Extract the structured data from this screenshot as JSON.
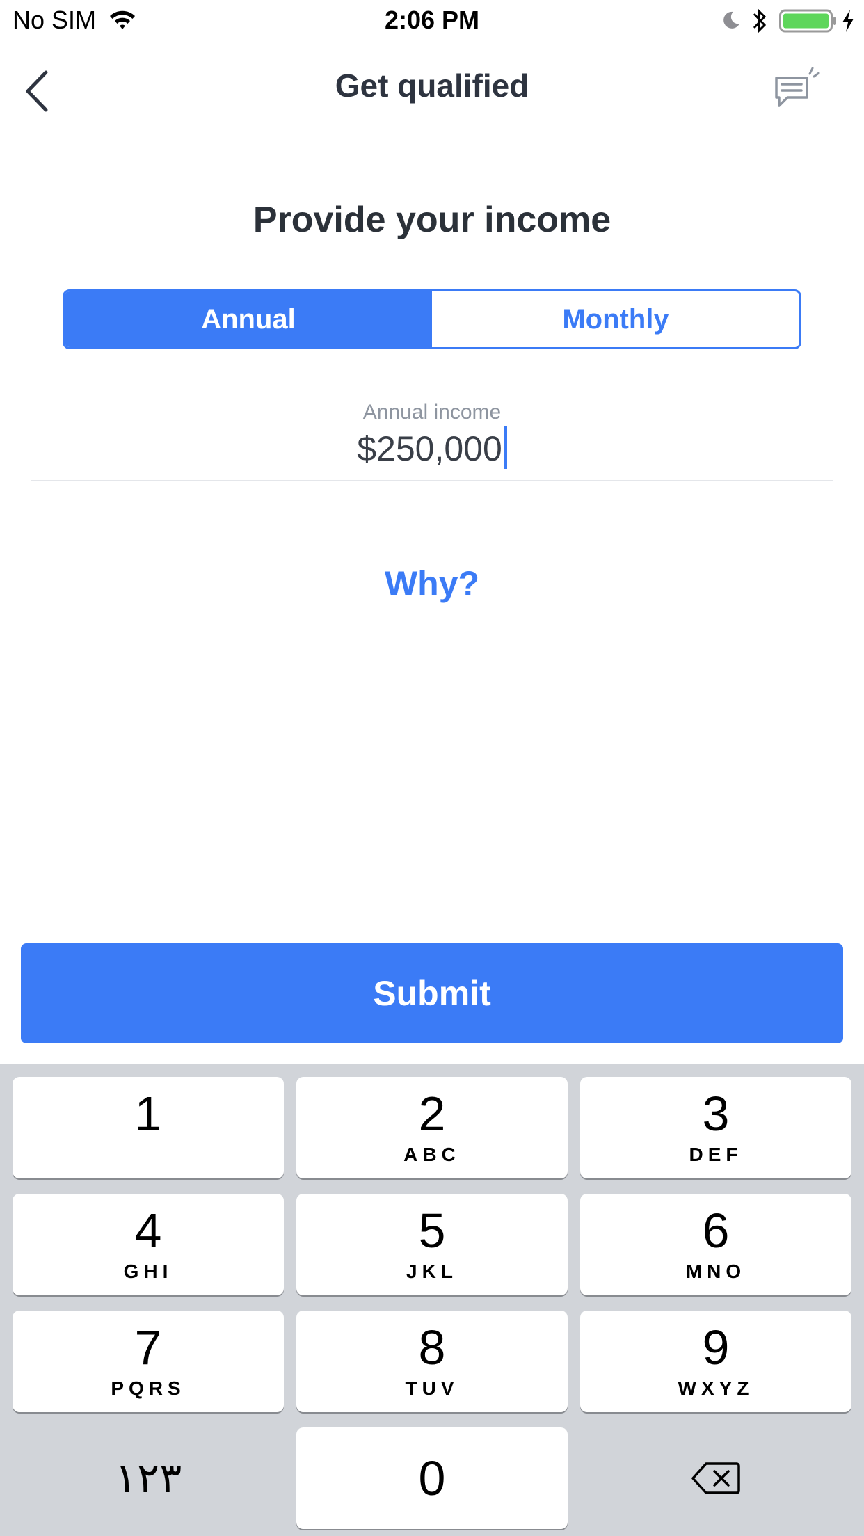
{
  "status_bar": {
    "carrier": "No SIM",
    "time": "2:06 PM",
    "battery_color": "#5ed65b"
  },
  "nav": {
    "title": "Get qualified",
    "back_icon": "chevron-left-icon",
    "chat_icon": "chat-bubble-icon"
  },
  "heading": "Provide your income",
  "segment": {
    "options": [
      "Annual",
      "Monthly"
    ],
    "selected": "Annual"
  },
  "income_field": {
    "label": "Annual income",
    "value": "$250,000"
  },
  "why_link": "Why?",
  "submit_label": "Submit",
  "keyboard": {
    "keys": [
      {
        "num": "1",
        "letters": ""
      },
      {
        "num": "2",
        "letters": "ABC"
      },
      {
        "num": "3",
        "letters": "DEF"
      },
      {
        "num": "4",
        "letters": "GHI"
      },
      {
        "num": "5",
        "letters": "JKL"
      },
      {
        "num": "6",
        "letters": "MNO"
      },
      {
        "num": "7",
        "letters": "PQRS"
      },
      {
        "num": "8",
        "letters": "TUV"
      },
      {
        "num": "9",
        "letters": "WXYZ"
      },
      {
        "num": "0",
        "letters": ""
      }
    ],
    "switch_label": "١٢٣",
    "delete_icon": "backspace-icon"
  },
  "colors": {
    "accent": "#3b7bf6",
    "title_text": "#2e3440",
    "keyboard_bg": "#d1d4d9"
  }
}
